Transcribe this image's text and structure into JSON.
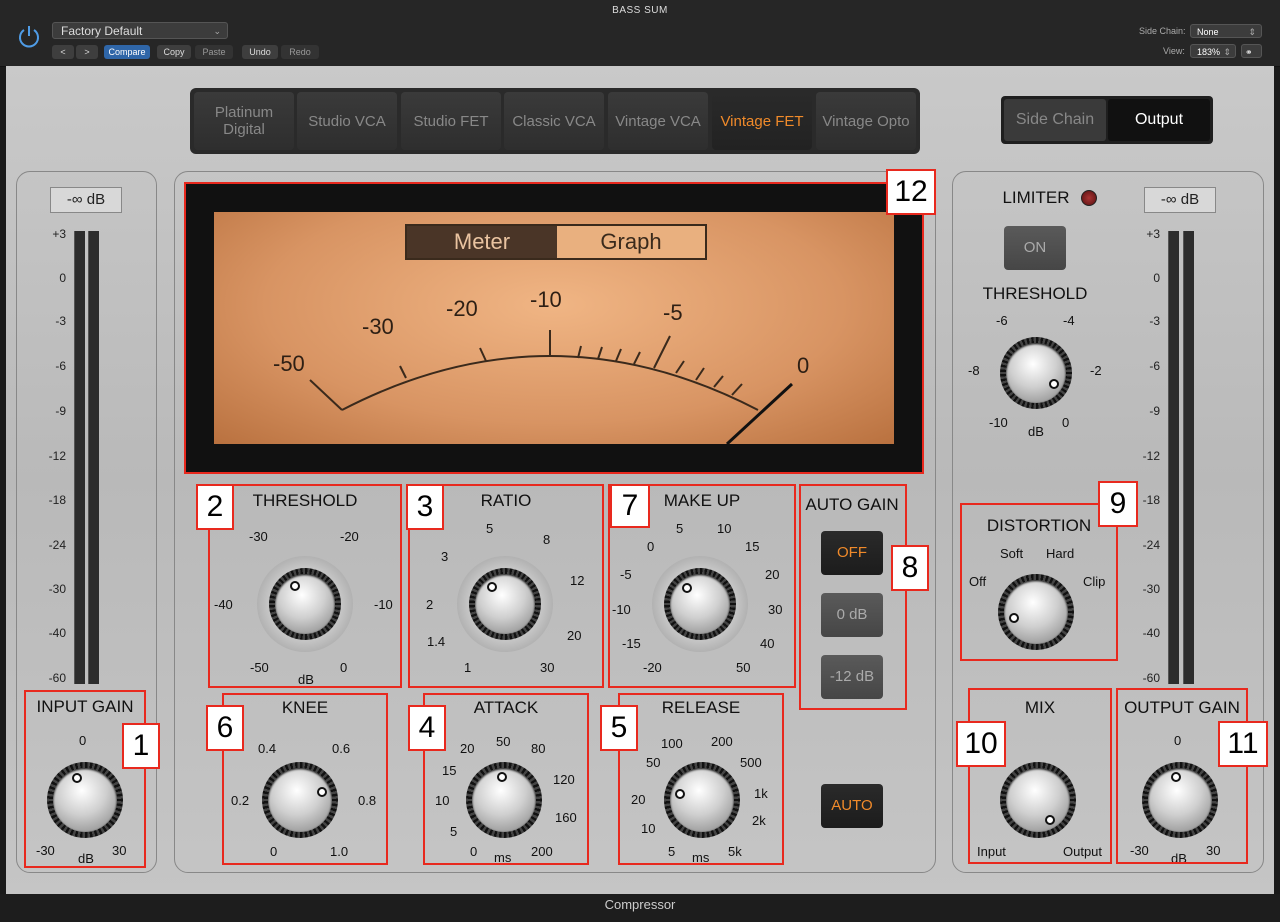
{
  "window": {
    "title": "BASS SUM",
    "footer": "Compressor"
  },
  "toolbar": {
    "preset": "Factory Default",
    "prev": "<",
    "next": ">",
    "compare": "Compare",
    "copy": "Copy",
    "paste": "Paste",
    "undo": "Undo",
    "redo": "Redo",
    "side_chain_label": "Side Chain:",
    "side_chain_value": "None",
    "view_label": "View:",
    "view_value": "183%"
  },
  "models": [
    "Platinum Digital",
    "Studio VCA",
    "Studio FET",
    "Classic VCA",
    "Vintage VCA",
    "Vintage FET",
    "Vintage Opto"
  ],
  "active_model": "Vintage FET",
  "view_toggle": {
    "side_chain": "Side Chain",
    "output": "Output"
  },
  "input_meter": {
    "readout": "-∞ dB",
    "scale": [
      "+3",
      "0",
      "-3",
      "-6",
      "-9",
      "-12",
      "-18",
      "-24",
      "-30",
      "-40",
      "-60"
    ]
  },
  "output_meter": {
    "readout": "-∞ dB",
    "scale": [
      "+3",
      "0",
      "-3",
      "-6",
      "-9",
      "-12",
      "-18",
      "-24",
      "-30",
      "-40",
      "-60"
    ]
  },
  "vu": {
    "toggle": {
      "meter": "Meter",
      "graph": "Graph"
    },
    "scale": [
      "-50",
      "-30",
      "-20",
      "-10",
      "-5",
      "0"
    ]
  },
  "controls": {
    "input_gain": {
      "label": "INPUT GAIN",
      "ticks": [
        "0",
        "-30",
        "dB",
        "30"
      ]
    },
    "threshold": {
      "label": "THRESHOLD",
      "ticks": [
        "-30",
        "-20",
        "-40",
        "-10",
        "-50",
        "dB",
        "0"
      ]
    },
    "ratio": {
      "label": "RATIO",
      "ticks": [
        "5",
        "8",
        "3",
        "12",
        "2",
        "20",
        "1.4",
        "1",
        "30"
      ]
    },
    "makeup": {
      "label": "MAKE UP",
      "ticks": [
        "5",
        "10",
        "0",
        "15",
        "-5",
        "20",
        "-10",
        "30",
        "-15",
        "40",
        "-20",
        "50"
      ]
    },
    "auto_gain": {
      "label": "AUTO GAIN",
      "off": "OFF",
      "zero": "0 dB",
      "minus12": "-12 dB"
    },
    "knee": {
      "label": "KNEE",
      "ticks": [
        "0.4",
        "0.6",
        "0.2",
        "0.8",
        "0",
        "1.0"
      ]
    },
    "attack": {
      "label": "ATTACK",
      "ticks": [
        "20",
        "50",
        "80",
        "15",
        "120",
        "10",
        "160",
        "5",
        "0",
        "ms",
        "200"
      ]
    },
    "release": {
      "label": "RELEASE",
      "ticks": [
        "100",
        "200",
        "50",
        "500",
        "20",
        "1k",
        "10",
        "2k",
        "5",
        "ms",
        "5k"
      ]
    },
    "auto": "AUTO",
    "limiter": {
      "label": "LIMITER",
      "on": "ON",
      "threshold": "THRESHOLD",
      "ticks": [
        "-6",
        "-4",
        "-8",
        "-2",
        "-10",
        "dB",
        "0"
      ]
    },
    "distortion": {
      "label": "DISTORTION",
      "ticks": [
        "Soft",
        "Hard",
        "Off",
        "Clip"
      ]
    },
    "mix": {
      "label": "MIX",
      "ticks": [
        "Input",
        "Output"
      ]
    },
    "output_gain": {
      "label": "OUTPUT GAIN",
      "ticks": [
        "0",
        "-30",
        "dB",
        "30"
      ]
    }
  },
  "callouts": [
    "1",
    "2",
    "3",
    "4",
    "5",
    "6",
    "7",
    "8",
    "9",
    "10",
    "11",
    "12"
  ]
}
